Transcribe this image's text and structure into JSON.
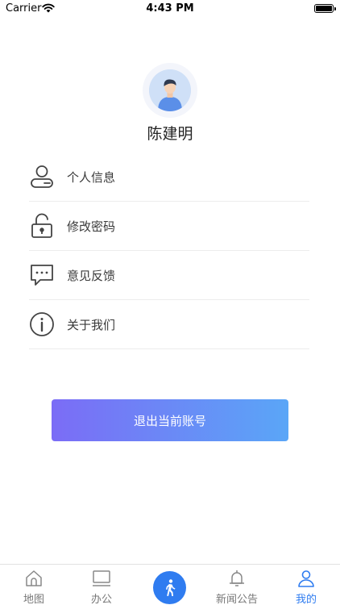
{
  "status_bar": {
    "carrier": "Carrier",
    "time": "4:43 PM",
    "wifi_icon": "wifi-icon",
    "battery_icon": "battery-icon"
  },
  "profile": {
    "avatar_icon": "user-avatar",
    "name": "陈建明"
  },
  "menu": {
    "items": [
      {
        "label": "个人信息",
        "icon": "person-icon"
      },
      {
        "label": "修改密码",
        "icon": "lock-icon"
      },
      {
        "label": "意见反馈",
        "icon": "chat-icon"
      },
      {
        "label": "关于我们",
        "icon": "info-icon"
      }
    ]
  },
  "logout": {
    "label": "退出当前账号",
    "colors": [
      "#7b6cf6",
      "#5aa6f7"
    ]
  },
  "tab_bar": {
    "accent_color": "#2f7cf0",
    "tabs": [
      {
        "label": "地图",
        "icon": "home-icon"
      },
      {
        "label": "办公",
        "icon": "monitor-icon"
      },
      {
        "label": "",
        "icon": "walking-icon"
      },
      {
        "label": "新闻公告",
        "icon": "bell-icon"
      },
      {
        "label": "我的",
        "icon": "user-icon",
        "active": true
      }
    ]
  }
}
